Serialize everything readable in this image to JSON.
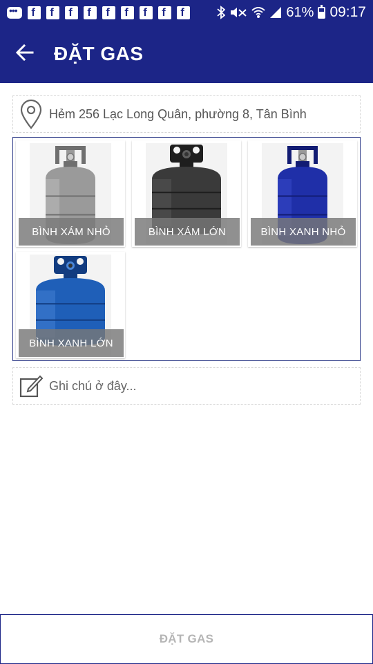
{
  "status_bar": {
    "battery_percent": "61%",
    "time": "09:17",
    "notification_icons": [
      "message-icon",
      "facebook-icon",
      "facebook-icon",
      "facebook-icon",
      "facebook-icon",
      "facebook-icon",
      "facebook-icon",
      "facebook-icon",
      "facebook-icon",
      "facebook-icon"
    ],
    "battery_level": 0.61
  },
  "app_bar": {
    "title": "ĐẶT GAS",
    "back_icon": "arrow-back-icon"
  },
  "address": {
    "icon": "location-pin-icon",
    "text": "Hẻm 256 Lạc Long Quân, phường 8, Tân Bình"
  },
  "products": [
    {
      "label": "BÌNH XÁM NHỎ",
      "color": "#9a9a9a",
      "dark": "#6f6f6f",
      "light": "#c4c4c4"
    },
    {
      "label": "BÌNH XÁM LỚN",
      "color": "#3a3a3a",
      "dark": "#1e1e1e",
      "light": "#5e5e5e"
    },
    {
      "label": "BÌNH XANH NHỎ",
      "color": "#1f2fa8",
      "dark": "#121c73",
      "light": "#3c4fd0"
    },
    {
      "label": "BÌNH XANH LỚN",
      "color": "#1f5fb8",
      "dark": "#123c80",
      "light": "#4a86d8"
    }
  ],
  "note": {
    "icon": "edit-note-icon",
    "placeholder": "Ghi chú ở đây..."
  },
  "order_button": {
    "label": "ĐẶT GAS"
  },
  "colors": {
    "primary": "#1c2587",
    "grid_border": "#2e3b88"
  }
}
